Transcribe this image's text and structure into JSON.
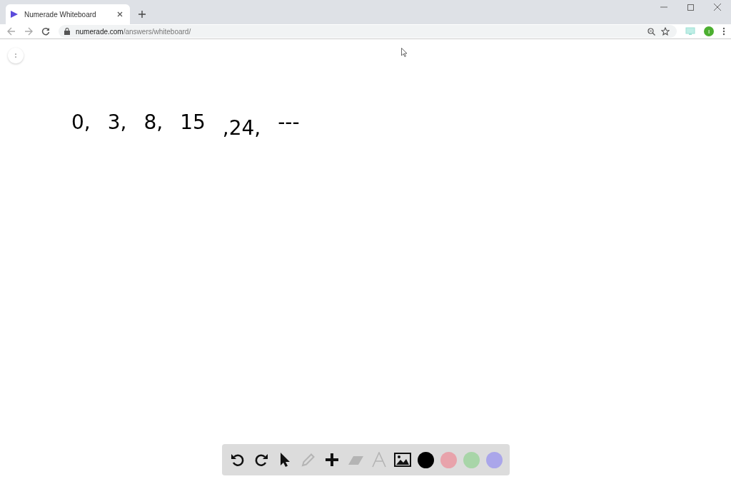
{
  "browser": {
    "tab": {
      "title": "Numerade Whiteboard"
    },
    "url": {
      "host": "numerade.com",
      "path": "/answers/whiteboard/"
    },
    "profile": {
      "initial": "I"
    }
  },
  "whiteboard": {
    "terms": [
      "0,",
      "3,",
      "8,",
      "15",
      ",24,",
      "---"
    ]
  },
  "toolbar": {
    "tools": [
      {
        "kind": "undo",
        "disabled": false
      },
      {
        "kind": "redo",
        "disabled": false
      },
      {
        "kind": "pointer",
        "disabled": false
      },
      {
        "kind": "pencil",
        "disabled": true
      },
      {
        "kind": "plus",
        "disabled": false
      },
      {
        "kind": "eraser",
        "disabled": true
      },
      {
        "kind": "text",
        "disabled": true
      },
      {
        "kind": "image",
        "disabled": false
      }
    ],
    "colors": [
      {
        "color": "#000000"
      },
      {
        "color": "#e8a3ab"
      },
      {
        "color": "#a8d5a8"
      },
      {
        "color": "#aaa6ea"
      }
    ]
  }
}
